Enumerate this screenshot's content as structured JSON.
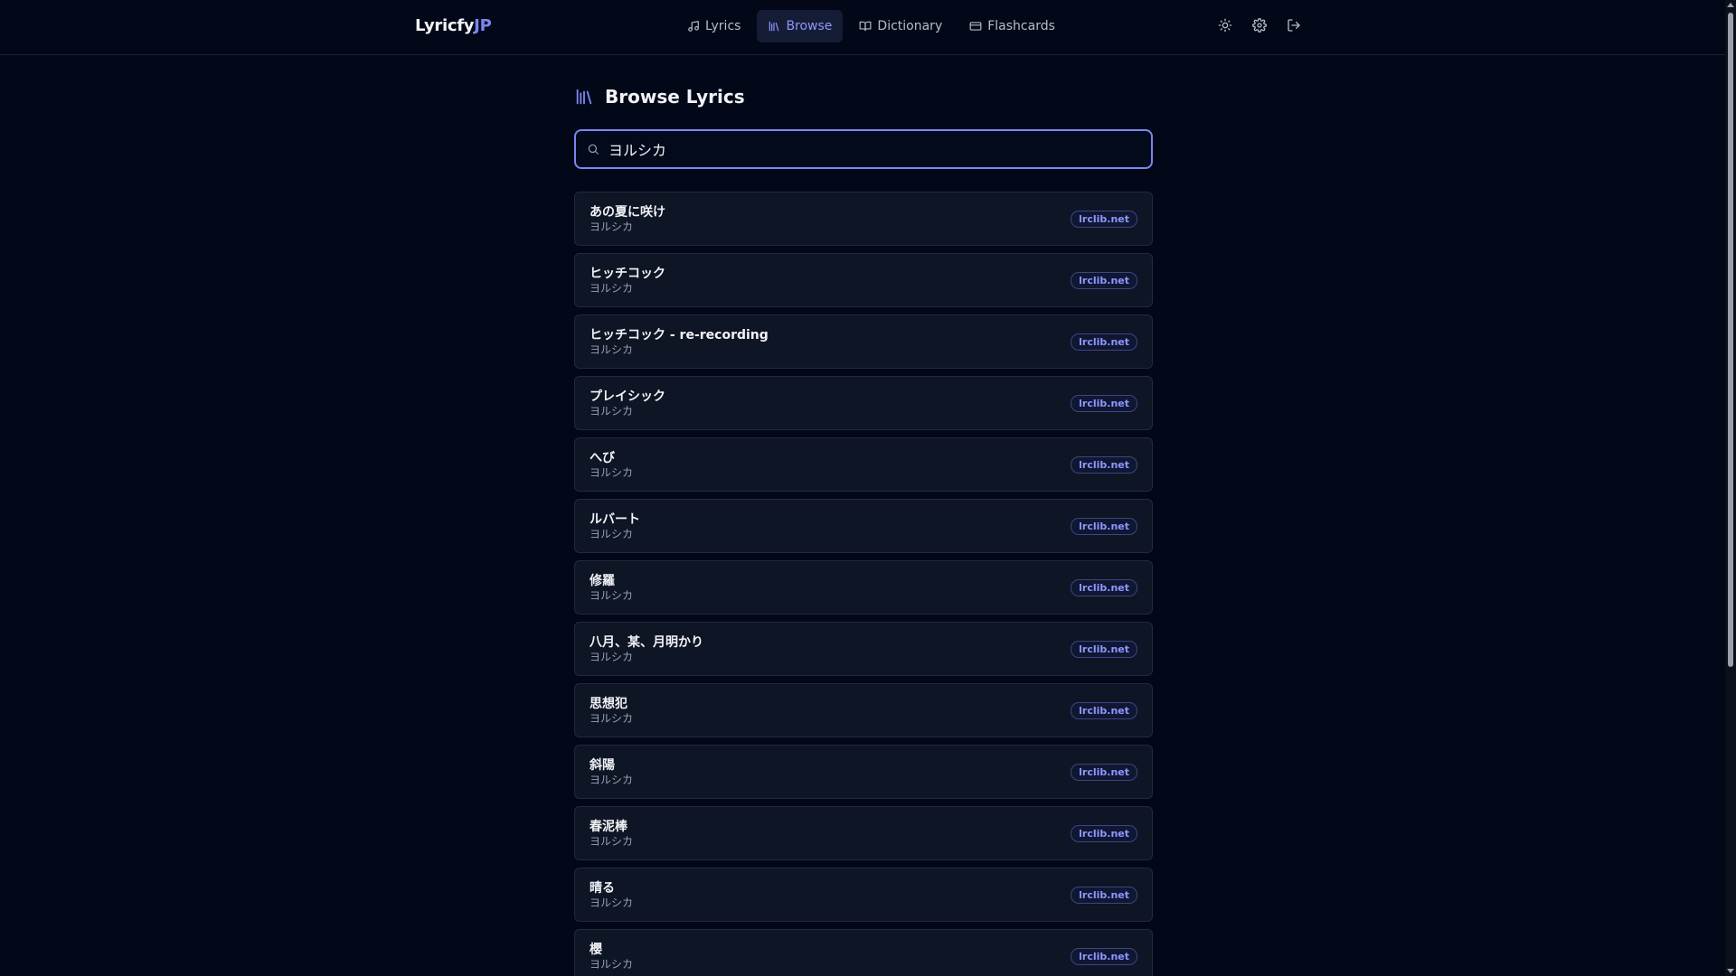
{
  "app": {
    "logo_main": "Lyricfy",
    "logo_accent": "JP"
  },
  "nav": {
    "items": [
      {
        "label": "Lyrics",
        "icon": "music-icon"
      },
      {
        "label": "Browse",
        "icon": "library-icon",
        "active": true
      },
      {
        "label": "Dictionary",
        "icon": "book-icon"
      },
      {
        "label": "Flashcards",
        "icon": "cards-icon"
      }
    ]
  },
  "header_actions": [
    "sun-icon",
    "gear-icon",
    "logout-icon"
  ],
  "page": {
    "title": "Browse Lyrics"
  },
  "search": {
    "value": "ヨルシカ"
  },
  "results": [
    {
      "title": "あの夏に咲け",
      "artist": "ヨルシカ",
      "source": "lrclib.net"
    },
    {
      "title": "ヒッチコック",
      "artist": "ヨルシカ",
      "source": "lrclib.net"
    },
    {
      "title": "ヒッチコック - re-recording",
      "artist": "ヨルシカ",
      "source": "lrclib.net"
    },
    {
      "title": "プレイシック",
      "artist": "ヨルシカ",
      "source": "lrclib.net"
    },
    {
      "title": "へび",
      "artist": "ヨルシカ",
      "source": "lrclib.net"
    },
    {
      "title": "ルバート",
      "artist": "ヨルシカ",
      "source": "lrclib.net"
    },
    {
      "title": "修羅",
      "artist": "ヨルシカ",
      "source": "lrclib.net"
    },
    {
      "title": "八月、某、月明かり",
      "artist": "ヨルシカ",
      "source": "lrclib.net"
    },
    {
      "title": "思想犯",
      "artist": "ヨルシカ",
      "source": "lrclib.net"
    },
    {
      "title": "斜陽",
      "artist": "ヨルシカ",
      "source": "lrclib.net"
    },
    {
      "title": "春泥棒",
      "artist": "ヨルシカ",
      "source": "lrclib.net"
    },
    {
      "title": "晴る",
      "artist": "ヨルシカ",
      "source": "lrclib.net"
    },
    {
      "title": "櫻",
      "artist": "ヨルシカ",
      "source": "lrclib.net"
    }
  ],
  "colors": {
    "background": "#020817",
    "accent": "#7b86f2",
    "card": "#0e1524"
  }
}
